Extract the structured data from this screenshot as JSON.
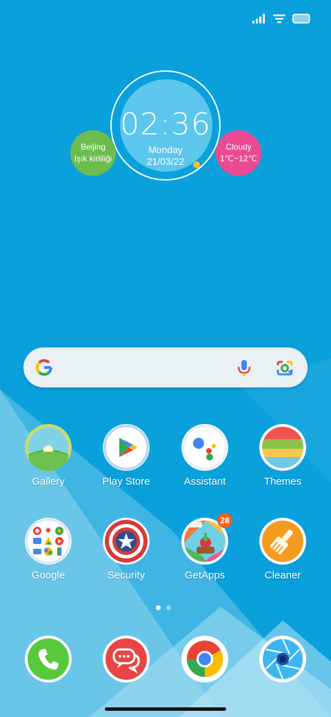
{
  "status_bar": {
    "signal_icon": "cellular-signal-icon",
    "wifi_icon": "wifi-icon",
    "battery_icon": "battery-icon"
  },
  "clock_widget": {
    "time": "02:36",
    "day": "Monday",
    "date": "21/03/22",
    "city": "Beijing",
    "city_sub": "Işık kirliliği",
    "weather": "Cloudy",
    "temp_range": "1℃~12℃"
  },
  "search_bar": {
    "logo": "google-g-icon",
    "mic": "microphone-icon",
    "lens": "google-lens-icon"
  },
  "apps": [
    {
      "label": "Gallery",
      "icon": "gallery-icon"
    },
    {
      "label": "Play Store",
      "icon": "play-store-icon"
    },
    {
      "label": "Assistant",
      "icon": "assistant-icon"
    },
    {
      "label": "Themes",
      "icon": "themes-icon"
    },
    {
      "label": "Google",
      "icon": "google-folder-icon"
    },
    {
      "label": "Security",
      "icon": "security-icon"
    },
    {
      "label": "GetApps",
      "icon": "getapps-icon",
      "badge": "28"
    },
    {
      "label": "Cleaner",
      "icon": "cleaner-icon"
    }
  ],
  "page_indicator": {
    "pages": 2,
    "current": 1
  },
  "dock": [
    {
      "icon": "phone-icon"
    },
    {
      "icon": "messaging-icon"
    },
    {
      "icon": "chrome-icon"
    },
    {
      "icon": "camera-icon"
    }
  ],
  "colors": {
    "wallpaper": "#0aa0dc",
    "city_bubble": "#6cbd4d",
    "weather_bubble": "#ec4a92",
    "badge": "#f2611c"
  }
}
